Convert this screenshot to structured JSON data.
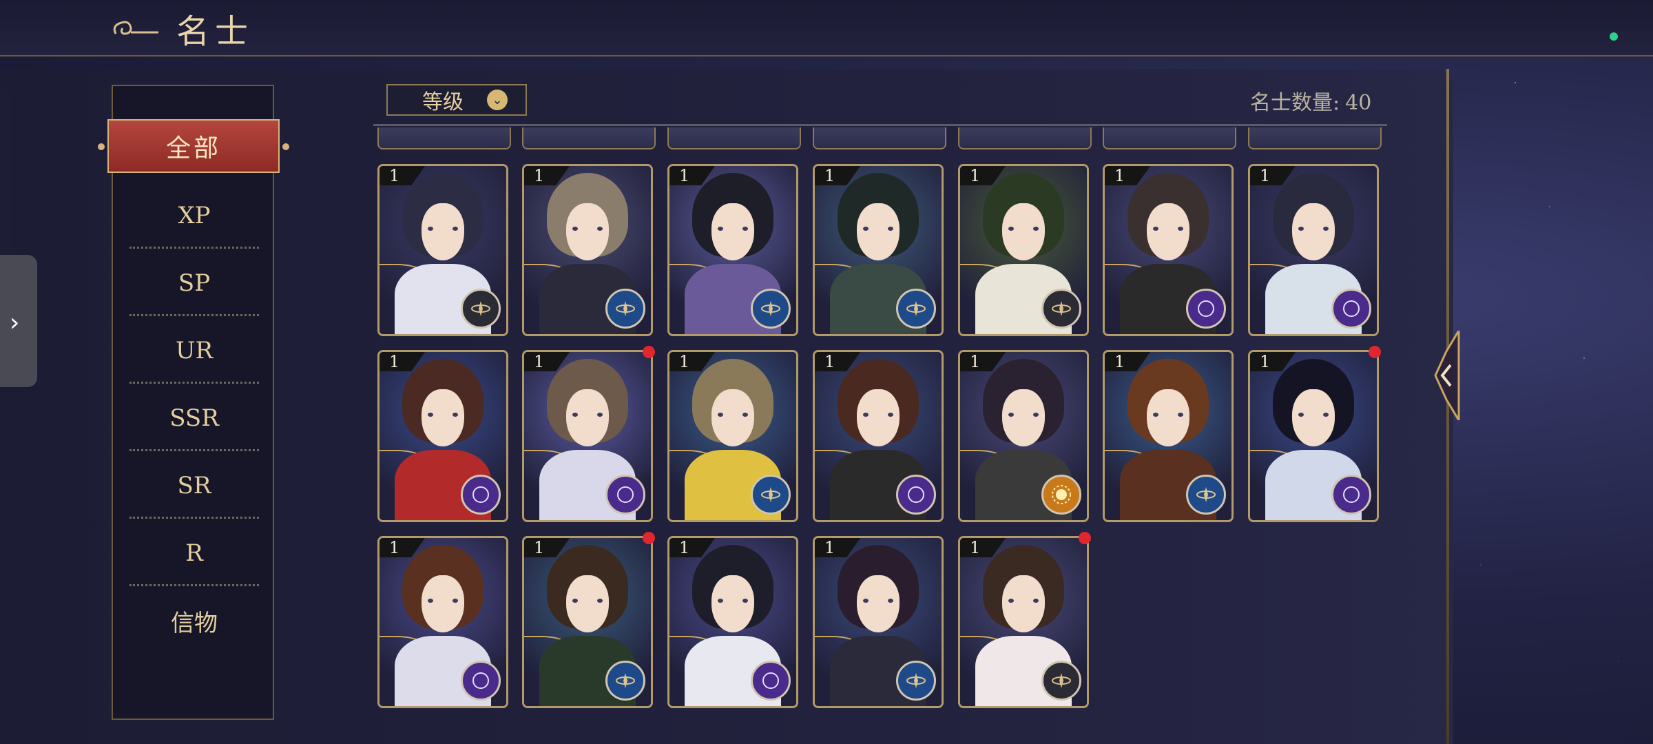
{
  "header": {
    "title": "名士"
  },
  "filter_tabs": {
    "active": "全部",
    "items": [
      "XP",
      "SP",
      "UR",
      "SSR",
      "SR",
      "R",
      "信物"
    ]
  },
  "sort": {
    "label": "等级"
  },
  "count": {
    "label": "名士数量:",
    "value": "40"
  },
  "colors": {
    "accent_gold": "#d7b774",
    "active_tab": "#a33a34",
    "notification": "#e0262e"
  },
  "cards": [
    {
      "level": "1",
      "attr": "gold-compass-icon",
      "notify": false
    },
    {
      "level": "1",
      "attr": "blue-compass-icon",
      "notify": false
    },
    {
      "level": "1",
      "attr": "blue-compass-icon",
      "notify": false
    },
    {
      "level": "1",
      "attr": "blue-compass-icon",
      "notify": false
    },
    {
      "level": "1",
      "attr": "gold-compass-icon",
      "notify": false
    },
    {
      "level": "1",
      "attr": "purple-moon-icon",
      "notify": false
    },
    {
      "level": "1",
      "attr": "purple-moon-icon",
      "notify": false
    },
    {
      "level": "1",
      "attr": "purple-moon-icon",
      "notify": false
    },
    {
      "level": "1",
      "attr": "purple-moon-icon",
      "notify": true
    },
    {
      "level": "1",
      "attr": "blue-compass-icon",
      "notify": false
    },
    {
      "level": "1",
      "attr": "purple-moon-icon",
      "notify": false
    },
    {
      "level": "1",
      "attr": "orange-sun-icon",
      "notify": false
    },
    {
      "level": "1",
      "attr": "blue-compass-icon",
      "notify": false
    },
    {
      "level": "1",
      "attr": "purple-moon-icon",
      "notify": true
    },
    {
      "level": "1",
      "attr": "purple-moon-icon",
      "notify": false
    },
    {
      "level": "1",
      "attr": "blue-compass-icon",
      "notify": true
    },
    {
      "level": "1",
      "attr": "purple-moon-icon",
      "notify": false
    },
    {
      "level": "1",
      "attr": "blue-compass-icon",
      "notify": false
    },
    {
      "level": "1",
      "attr": "gold-compass-icon",
      "notify": true
    }
  ]
}
